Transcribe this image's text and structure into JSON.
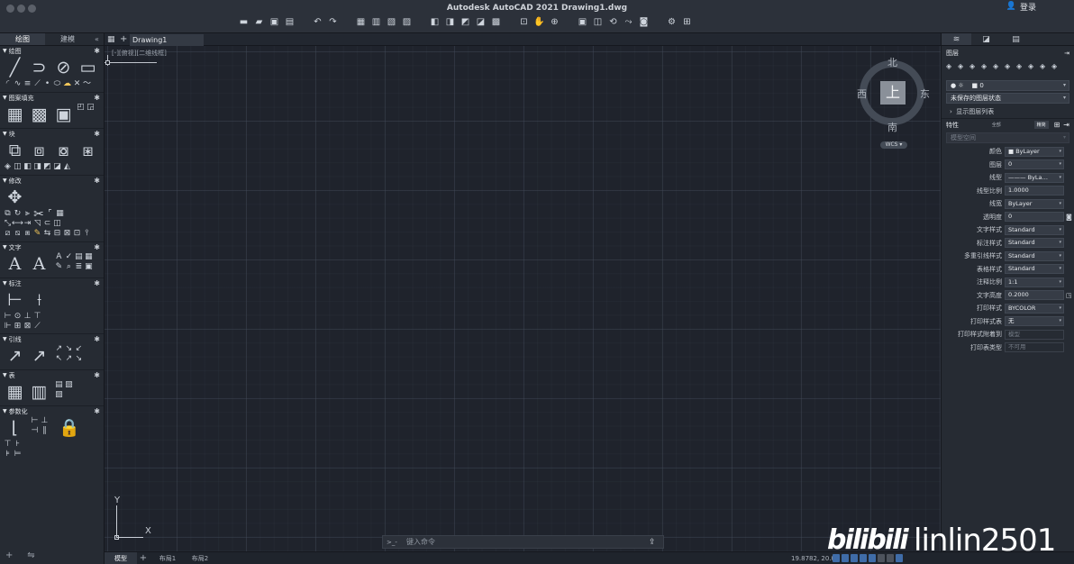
{
  "window": {
    "title": "Autodesk AutoCAD 2021    Drawing1.dwg",
    "login": "登录"
  },
  "left_panel": {
    "tabs": [
      "绘图",
      "建模"
    ],
    "sections": [
      {
        "name": "绘图"
      },
      {
        "name": "图案填充"
      },
      {
        "name": "块"
      },
      {
        "name": "修改"
      },
      {
        "name": "文字"
      },
      {
        "name": "标注"
      },
      {
        "name": "引线"
      },
      {
        "name": "表"
      },
      {
        "name": "参数化"
      }
    ]
  },
  "document": {
    "tab": "Drawing1"
  },
  "canvas": {
    "view_label": "[-][俯视][二维线框]"
  },
  "viewcube": {
    "north": "北",
    "south": "南",
    "east": "东",
    "west": "西",
    "face": "上",
    "wcs": "WCS ▾"
  },
  "ucs": {
    "x": "X",
    "y": "Y"
  },
  "command": {
    "prompt": ">_-",
    "placeholder": "键入命令"
  },
  "status": {
    "tabs": [
      "模型",
      "布局1",
      "布局2"
    ],
    "coords": "19.8782, 20.0"
  },
  "right_panel": {
    "layers_title": "图层",
    "layer_current": "0",
    "layer_state": "未保存的图层状态",
    "layer_list": "显示图层列表",
    "props_title": "特性",
    "props_btn_all": "全部",
    "props_btn_basic": "精简",
    "space": "模型空间",
    "properties": [
      {
        "label": "颜色",
        "value": "■ ByLayer",
        "dd": true
      },
      {
        "label": "图层",
        "value": "0",
        "dd": true
      },
      {
        "label": "线型",
        "value": "——— ByLa…",
        "dd": true
      },
      {
        "label": "线型比例",
        "value": "1.0000",
        "dd": false
      },
      {
        "label": "线宽",
        "value": "ByLayer",
        "dd": true
      },
      {
        "label": "透明度",
        "value": "0",
        "dd": false
      },
      {
        "label": "文字样式",
        "value": "Standard",
        "dd": true
      },
      {
        "label": "标注样式",
        "value": "Standard",
        "dd": true
      },
      {
        "label": "多重引线样式",
        "value": "Standard",
        "dd": true
      },
      {
        "label": "表格样式",
        "value": "Standard",
        "dd": true
      },
      {
        "label": "注释比例",
        "value": "1:1",
        "dd": true
      },
      {
        "label": "文字高度",
        "value": "0.2000",
        "dd": false
      },
      {
        "label": "打印样式",
        "value": "BYCOLOR",
        "dd": true
      },
      {
        "label": "打印样式表",
        "value": "无",
        "dd": true
      },
      {
        "label": "打印样式附着到",
        "value": "模型",
        "dd": false,
        "ro": true
      },
      {
        "label": "打印表类型",
        "value": "不可用",
        "dd": false,
        "ro": true
      }
    ]
  },
  "watermark": {
    "logo": "bilibili",
    "user": "linlin2501"
  }
}
